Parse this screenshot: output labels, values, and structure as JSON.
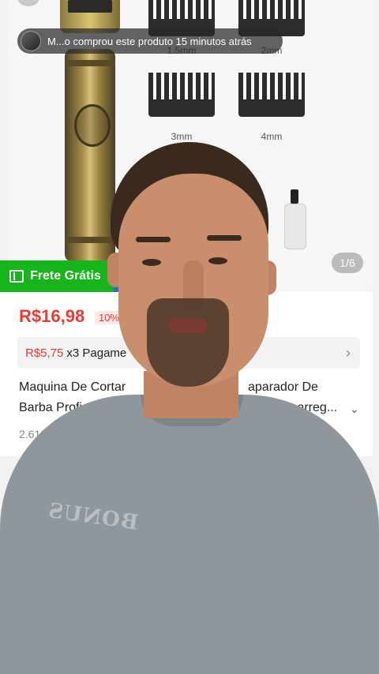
{
  "notification": {
    "text": "M...o comprou este produto 15 minutos atrás"
  },
  "gallery": {
    "comb_sizes": [
      "1.5mm",
      "2mm",
      "3mm",
      "4mm"
    ],
    "counter": "1/6"
  },
  "badge": {
    "label": "Frete Grátis",
    "color": "#15b51b"
  },
  "product": {
    "price": "R$16,98",
    "discount": "10%",
    "installment_price": "R$5,75",
    "installment_text": "x3 Pagame",
    "title_line1_a": "Maquina De Cortar",
    "title_line1_b": "aparador De",
    "title_line2_a": "Barba Profi",
    "title_line2_b": "Recarreg...",
    "sold": "2.610"
  },
  "overlay": {
    "shirt_logo": "BONUS"
  },
  "colors": {
    "price": "#ee3a2f",
    "accent_blue": "#1e6fd6"
  }
}
